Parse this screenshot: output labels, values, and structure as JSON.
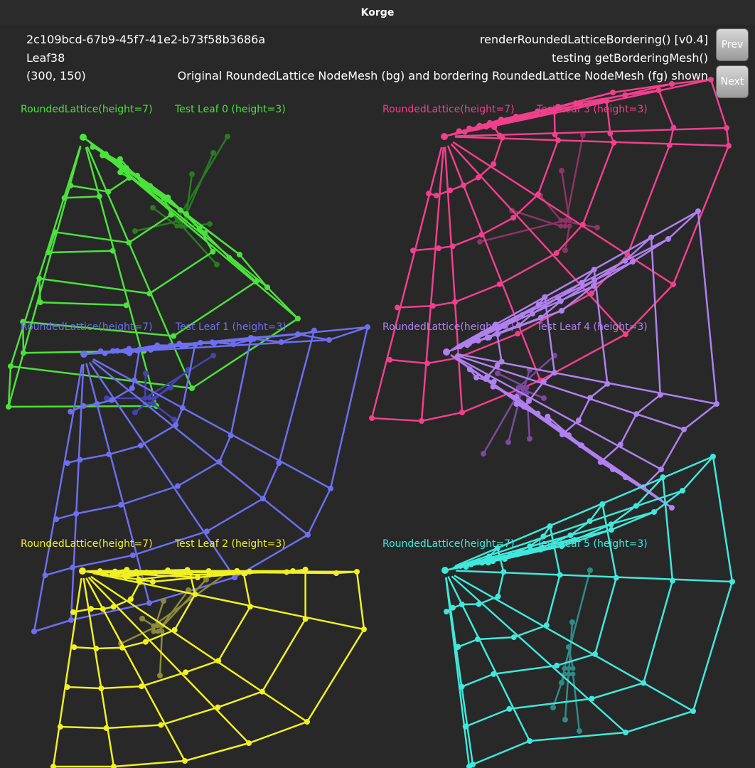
{
  "window": {
    "title": "Korge"
  },
  "info": {
    "uuid": "2c109bcd-67b9-45f7-41e2-b73f58b3686a",
    "leaf": "Leaf38",
    "coords": "(300, 150)",
    "function": "renderRoundedLatticeBordering() [v0.4]",
    "testing": "testing getBorderingMesh()",
    "description": "Original RoundedLattice NodeMesh (bg) and bordering RoundedLattice NodeMesh (fg) shown"
  },
  "buttons": {
    "prev": "Prev",
    "next": "Next"
  },
  "panels": [
    {
      "lattice": "RoundedLattice(height=7)",
      "leaf": "Test Leaf 0 (height=3)",
      "color": "#4ce23c",
      "dim": "#2a7a22"
    },
    {
      "lattice": "RoundedLattice(height=7)",
      "leaf": "Test Leaf 1 (height=3)",
      "color": "#6e6ef0",
      "dim": "#4444b0"
    },
    {
      "lattice": "RoundedLattice(height=7)",
      "leaf": "Test Leaf 2 (height=3)",
      "color": "#f0f023",
      "dim": "#8c8a3a"
    },
    {
      "lattice": "RoundedLattice(height=7)",
      "leaf": "Test Leaf 3 (height=3)",
      "color": "#f0408c",
      "dim": "#8c3462"
    },
    {
      "lattice": "RoundedLattice(height=7)",
      "leaf": "Test Leaf 4 (height=3)",
      "color": "#b080f0",
      "dim": "#7a4a9e"
    },
    {
      "lattice": "RoundedLattice(height=7)",
      "leaf": "Test Leaf 5 (height=3)",
      "color": "#40e8dc",
      "dim": "#2e8c88"
    }
  ]
}
